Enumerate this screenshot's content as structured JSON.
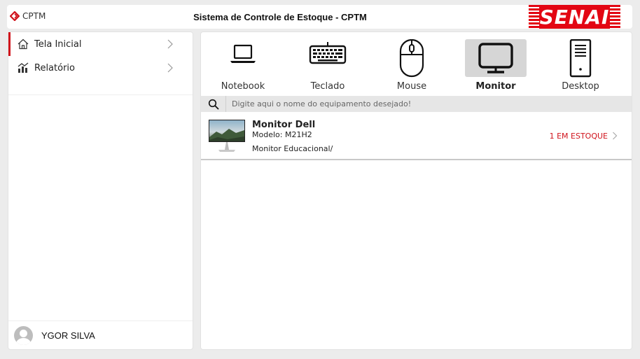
{
  "header": {
    "brand_text": "CPTM",
    "title": "Sistema de Controle de Estoque - CPTM",
    "logo_text": "SENAI"
  },
  "sidebar": {
    "items": [
      {
        "label": "Tela Inicial",
        "icon": "home-icon",
        "active": true
      },
      {
        "label": "Relatório",
        "icon": "chart-icon",
        "active": false
      }
    ],
    "user": {
      "name": "YGOR SILVA",
      "icon": "avatar-icon"
    }
  },
  "categories": [
    {
      "label": "Notebook",
      "icon": "laptop-icon",
      "selected": false
    },
    {
      "label": "Teclado",
      "icon": "keyboard-icon",
      "selected": false
    },
    {
      "label": "Mouse",
      "icon": "mouse-icon",
      "selected": false
    },
    {
      "label": "Monitor",
      "icon": "monitor-icon",
      "selected": true
    },
    {
      "label": "Desktop",
      "icon": "desktop-tower-icon",
      "selected": false
    }
  ],
  "search": {
    "placeholder": "Digite aqui o nome do equipamento desejado!",
    "value": ""
  },
  "results": [
    {
      "title": "Monitor Dell",
      "model": "Modelo: M21H2",
      "description": "Monitor Educacional/",
      "stock": "1 EM ESTOQUE"
    }
  ],
  "colors": {
    "accent_red": "#d0121b",
    "selected_bg": "#d6d6d6",
    "senai_red": "#e30613"
  }
}
